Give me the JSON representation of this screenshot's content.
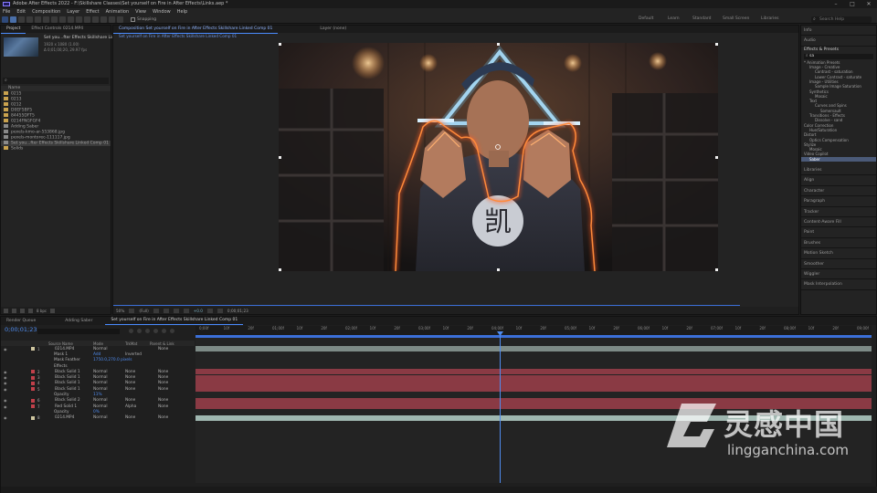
{
  "app": {
    "title": "Adobe After Effects 2022 - F:\\Skillshare Classes\\Set yourself on Fire in After Effects\\Links.aep *",
    "menu": [
      "File",
      "Edit",
      "Composition",
      "Layer",
      "Effect",
      "Animation",
      "View",
      "Window",
      "Help"
    ],
    "snapping_label": "Snapping",
    "workspaces": [
      "Default",
      "Learn",
      "Standard",
      "Small Screen",
      "Libraries"
    ],
    "search_placeholder": "Search Help"
  },
  "project_panel": {
    "tab_project": "Project",
    "tab_effect_controls": "Effect Controls  0214.MP4",
    "selected_name": "Set you...fter Effects Skillshare Linked Comp 01",
    "selected_info1": "1920 x 1080 (1.00)",
    "selected_info2": "Δ 0;01;00;20, 29.97 fps",
    "search_placeholder": "",
    "col_name": "Name",
    "items": [
      {
        "name": "0215",
        "color": "#c9a24e"
      },
      {
        "name": "0213",
        "color": "#c9a24e"
      },
      {
        "name": "0212",
        "color": "#c9a24e"
      },
      {
        "name": "D0EF5BF5",
        "color": "#c9a24e"
      },
      {
        "name": "84455DFT5",
        "color": "#c9a24e"
      },
      {
        "name": "0214FNGFGF4",
        "color": "#c9a24e"
      },
      {
        "name": "Adding Saber",
        "color": "#8a8a8a"
      },
      {
        "name": "pexels-kmo-ar-553868.jpg",
        "color": "#8a8a8a"
      },
      {
        "name": "pexels-montorec-111117.jpg",
        "color": "#8a8a8a"
      },
      {
        "name": "Set you...fter Effects Skillshare Linked Comp 01",
        "color": "#8a8a8a"
      },
      {
        "name": "Solids",
        "color": "#c9a24e"
      }
    ],
    "bpc": "8 bpc"
  },
  "comp_panel": {
    "tab": "Composition  Set yourself on Fire in After Effects Skillshare Linked Comp 01",
    "breadcrumb": "Set yourself on Fire in After Effects Skillshare Linked Comp 01",
    "layer_tab": "Layer  (none)",
    "zoom": "50%",
    "resolution": "(Full)",
    "exposure": "+0.0",
    "timecode": "0;00;01;23",
    "tshirt_glyph": "凯"
  },
  "right_panel": {
    "top_items": [
      "Info",
      "Audio"
    ],
    "effects_title": "Effects & Presets",
    "search_value": "sa",
    "tree": [
      {
        "label": "* Animation Presets",
        "indent": 0
      },
      {
        "label": "Image - Creative",
        "indent": 1
      },
      {
        "label": "Contrast - saturation",
        "indent": 2
      },
      {
        "label": "Lower Contrast - saturate",
        "indent": 2
      },
      {
        "label": "Image - Utilities",
        "indent": 1
      },
      {
        "label": "Sample Image Saturation",
        "indent": 2
      },
      {
        "label": "Synthetics",
        "indent": 1
      },
      {
        "label": "Mosaic",
        "indent": 2
      },
      {
        "label": "Text",
        "indent": 1
      },
      {
        "label": "Curves and Spins",
        "indent": 2
      },
      {
        "label": "Somersault",
        "indent": 3
      },
      {
        "label": "Transitions - Effects",
        "indent": 1
      },
      {
        "label": "Dissolve - sand",
        "indent": 2
      },
      {
        "label": "Color Correction",
        "indent": 0
      },
      {
        "label": "Hue/Saturation",
        "indent": 1
      },
      {
        "label": "Distort",
        "indent": 0
      },
      {
        "label": "Optics Compensation",
        "indent": 1
      },
      {
        "label": "Stylize",
        "indent": 0
      },
      {
        "label": "Mosaic",
        "indent": 1
      },
      {
        "label": "Video Copilot",
        "indent": 0
      },
      {
        "label": "Saber",
        "indent": 1,
        "selected": true
      }
    ],
    "sections": [
      "Libraries",
      "Align",
      "Character",
      "Paragraph",
      "Tracker",
      "Content-Aware Fill",
      "Paint",
      "Brushes",
      "Motion Sketch",
      "Smoother",
      "Wiggler",
      "Mask Interpolation"
    ]
  },
  "timeline": {
    "tabs": [
      "Render Queue",
      "Adding Saber",
      "Set yourself on Fire in After Effects Skillshare Linked Comp 01"
    ],
    "timecode": "0;00;01;23",
    "columns": {
      "source": "Source Name",
      "mode": "Mode",
      "trkmat": "TrkMat",
      "parent": "Parent & Link"
    },
    "ruler": [
      "0;00f",
      "10f",
      "20f",
      "01;00f",
      "10f",
      "20f",
      "02;00f",
      "10f",
      "20f",
      "03;00f",
      "10f",
      "20f",
      "04;00f",
      "10f",
      "20f",
      "05;00f",
      "10f",
      "20f",
      "06;00f",
      "10f",
      "20f",
      "07;00f",
      "10f",
      "20f",
      "08;00f",
      "10f",
      "20f",
      "09;00f"
    ],
    "layers": [
      {
        "num": "1",
        "name": "0214.MP4",
        "mode": "Normal",
        "trk": "",
        "parent": "None",
        "color": "#cfc6a0",
        "type": "video"
      },
      {
        "num": "",
        "name": "Mask 1",
        "mode": "Add",
        "trk": "Inverted",
        "parent": "",
        "color": "",
        "type": "prop"
      },
      {
        "num": "",
        "name": "Mask Feather",
        "mode": "1750.0,270.0 pixels",
        "trk": "",
        "parent": "",
        "color": "",
        "type": "prop"
      },
      {
        "num": "",
        "name": "Effects",
        "mode": "",
        "trk": "",
        "parent": "",
        "color": "",
        "type": "prop"
      },
      {
        "num": "2",
        "name": "Black Solid 1",
        "mode": "Normal",
        "trk": "None",
        "parent": "None",
        "color": "#c0404a",
        "type": "solid"
      },
      {
        "num": "3",
        "name": "Black Solid 1",
        "mode": "Normal",
        "trk": "None",
        "parent": "None",
        "color": "#c0404a",
        "type": "solid"
      },
      {
        "num": "4",
        "name": "Black Solid 1",
        "mode": "Normal",
        "trk": "None",
        "parent": "None",
        "color": "#c0404a",
        "type": "solid"
      },
      {
        "num": "5",
        "name": "Black Solid 1",
        "mode": "Normal",
        "trk": "None",
        "parent": "None",
        "color": "#c0404a",
        "type": "solid"
      },
      {
        "num": "",
        "name": "Opacity",
        "mode": "11%",
        "trk": "",
        "parent": "",
        "color": "",
        "type": "prop"
      },
      {
        "num": "6",
        "name": "Black Solid 2",
        "mode": "Normal",
        "trk": "None",
        "parent": "None",
        "color": "#c0404a",
        "type": "solid"
      },
      {
        "num": "7",
        "name": "Red Solid 1",
        "mode": "Normal",
        "trk": "Alpha",
        "parent": "None",
        "color": "#c0404a",
        "type": "solid"
      },
      {
        "num": "",
        "name": "Opacity",
        "mode": "0%",
        "trk": "",
        "parent": "",
        "color": "",
        "type": "prop"
      },
      {
        "num": "8",
        "name": "0214.MP4",
        "mode": "Normal",
        "trk": "None",
        "parent": "None",
        "color": "#cfc6a0",
        "type": "video"
      }
    ]
  },
  "watermark": {
    "brand_cn": "灵感中国",
    "url": "lingganchina.com"
  }
}
